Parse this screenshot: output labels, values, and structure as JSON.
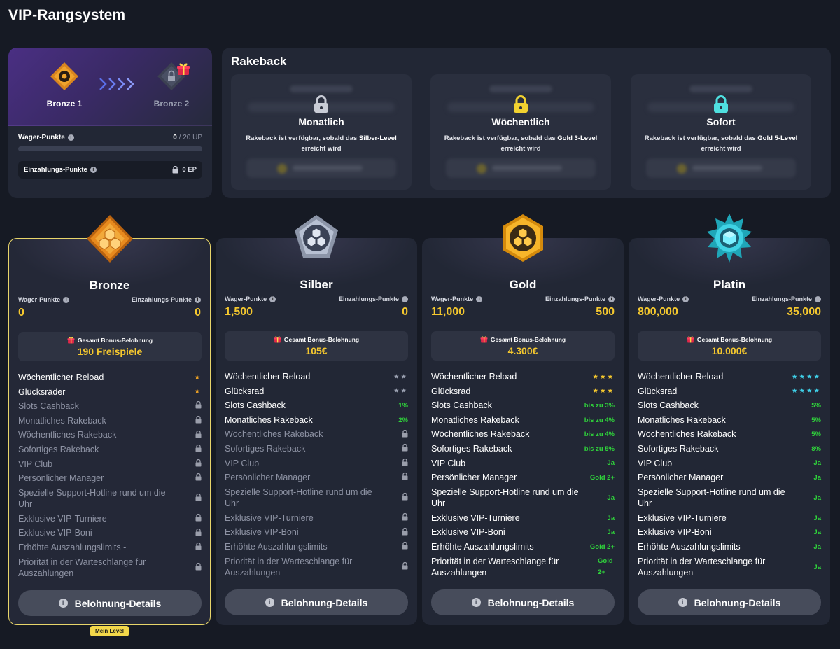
{
  "page": {
    "title": "VIP-Rangsystem"
  },
  "progress": {
    "current_rank": "Bronze 1",
    "next_rank": "Bronze 2",
    "wager_label": "Wager-Punkte",
    "wager_current": "0",
    "wager_target": "/ 20 UP",
    "wager_fraction": 0,
    "deposit_label": "Einzahlungs-Punkte",
    "deposit_value": "0 EP"
  },
  "rakeback": {
    "title": "Rakeback",
    "tiles": [
      {
        "name": "Monatlich",
        "desc_pre": "Rakeback ist verfügbar, sobald das ",
        "desc_bold": "Silber-Level",
        "desc_post": " erreicht wird",
        "lock_color": "#c9ccd6"
      },
      {
        "name": "Wöchentlich",
        "desc_pre": "Rakeback ist verfügbar, sobald das ",
        "desc_bold": "Gold 3-Level",
        "desc_post": " erreicht wird",
        "lock_color": "#f2d230"
      },
      {
        "name": "Sofort",
        "desc_pre": "Rakeback ist verfügbar, sobald das ",
        "desc_bold": "Gold 5-Level",
        "desc_post": " erreicht wird",
        "lock_color": "#4fe0e0"
      }
    ]
  },
  "labels": {
    "wager": "Wager-Punkte",
    "deposit": "Einzahlungs-Punkte",
    "bonus_total": "Gesamt Bonus-Belohnung",
    "details_button": "Belohnung-Details",
    "my_level": "Mein Level"
  },
  "tiers": [
    {
      "name": "Bronze",
      "wager": "0",
      "deposit": "0",
      "bonus": "190 Freispiele",
      "features": [
        {
          "name": "Wöchentlicher Reload",
          "value": "★",
          "type": "stars",
          "color": "#f5a623",
          "on": true
        },
        {
          "name": "Glücksräder",
          "value": "★",
          "type": "stars",
          "color": "#f5a623",
          "on": true
        },
        {
          "name": "Slots Cashback",
          "type": "lock"
        },
        {
          "name": "Monatliches Rakeback",
          "type": "lock"
        },
        {
          "name": "Wöchentliches Rakeback",
          "type": "lock"
        },
        {
          "name": "Sofortiges Rakeback",
          "type": "lock"
        },
        {
          "name": "VIP Club",
          "type": "lock"
        },
        {
          "name": "Persönlicher Manager",
          "type": "lock"
        },
        {
          "name": "Spezielle Support-Hotline rund um die Uhr",
          "type": "lock",
          "tall": true
        },
        {
          "name": "Exklusive VIP-Turniere",
          "type": "lock"
        },
        {
          "name": "Exklusive VIP-Boni",
          "type": "lock"
        },
        {
          "name": "Erhöhte Auszahlungslimits -",
          "type": "lock"
        },
        {
          "name": "Priorität in der Warteschlange für Auszahlungen",
          "type": "lock",
          "tall": true
        }
      ]
    },
    {
      "name": "Silber",
      "wager": "1,500",
      "deposit": "0",
      "bonus": "105€",
      "features": [
        {
          "name": "Wöchentlicher Reload",
          "value": "★★",
          "type": "stars",
          "color": "#9aa0b0",
          "on": true
        },
        {
          "name": "Glücksrad",
          "value": "★★",
          "type": "stars",
          "color": "#9aa0b0",
          "on": true
        },
        {
          "name": "Slots Cashback",
          "value": "1%",
          "type": "text",
          "on": true
        },
        {
          "name": "Monatliches Rakeback",
          "value": "2%",
          "type": "text",
          "on": true
        },
        {
          "name": "Wöchentliches Rakeback",
          "type": "lock"
        },
        {
          "name": "Sofortiges Rakeback",
          "type": "lock"
        },
        {
          "name": "VIP Club",
          "type": "lock"
        },
        {
          "name": "Persönlicher Manager",
          "type": "lock"
        },
        {
          "name": "Spezielle Support-Hotline rund um die Uhr",
          "type": "lock",
          "tall": true
        },
        {
          "name": "Exklusive VIP-Turniere",
          "type": "lock"
        },
        {
          "name": "Exklusive VIP-Boni",
          "type": "lock"
        },
        {
          "name": "Erhöhte Auszahlungslimits -",
          "type": "lock"
        },
        {
          "name": "Priorität in der Warteschlange für Auszahlungen",
          "type": "lock",
          "tall": true
        }
      ]
    },
    {
      "name": "Gold",
      "wager": "11,000",
      "deposit": "500",
      "bonus": "4.300€",
      "features": [
        {
          "name": "Wöchentlicher Reload",
          "value": "★★★",
          "type": "stars",
          "color": "#f5c82e",
          "on": true
        },
        {
          "name": "Glücksrad",
          "value": "★★★",
          "type": "stars",
          "color": "#f5c82e",
          "on": true
        },
        {
          "name": "Slots Cashback",
          "value": "bis zu 3%",
          "type": "text",
          "on": true
        },
        {
          "name": "Monatliches Rakeback",
          "value": "bis zu 4%",
          "type": "text",
          "on": true
        },
        {
          "name": "Wöchentliches Rakeback",
          "value": "bis zu 4%",
          "type": "text",
          "on": true
        },
        {
          "name": "Sofortiges Rakeback",
          "value": "bis zu 5%",
          "type": "text",
          "on": true
        },
        {
          "name": "VIP Club",
          "value": "Ja",
          "type": "text",
          "on": true
        },
        {
          "name": "Persönlicher Manager",
          "value": "Gold 2+",
          "type": "text",
          "on": true
        },
        {
          "name": "Spezielle Support-Hotline rund um die Uhr",
          "value": "Ja",
          "type": "text",
          "on": true,
          "tall": true
        },
        {
          "name": "Exklusive VIP-Turniere",
          "value": "Ja",
          "type": "text",
          "on": true
        },
        {
          "name": "Exklusive VIP-Boni",
          "value": "Ja",
          "type": "text",
          "on": true
        },
        {
          "name": "Erhöhte Auszahlungslimits -",
          "value": "Gold 2+",
          "type": "text",
          "on": true
        },
        {
          "name": "Priorität in der Warteschlange für Auszahlungen",
          "value": "Gold 2+",
          "type": "text",
          "on": true,
          "tall": true,
          "wrap": true
        }
      ]
    },
    {
      "name": "Platin",
      "wager": "800,000",
      "deposit": "35,000",
      "bonus": "10.000€",
      "features": [
        {
          "name": "Wöchentlicher Reload",
          "value": "★★★★",
          "type": "stars",
          "color": "#3fd0e8",
          "on": true
        },
        {
          "name": "Glücksrad",
          "value": "★★★★",
          "type": "stars",
          "color": "#3fd0e8",
          "on": true
        },
        {
          "name": "Slots Cashback",
          "value": "5%",
          "type": "text",
          "on": true
        },
        {
          "name": "Monatliches Rakeback",
          "value": "5%",
          "type": "text",
          "on": true
        },
        {
          "name": "Wöchentliches Rakeback",
          "value": "5%",
          "type": "text",
          "on": true
        },
        {
          "name": "Sofortiges Rakeback",
          "value": "8%",
          "type": "text",
          "on": true
        },
        {
          "name": "VIP Club",
          "value": "Ja",
          "type": "text",
          "on": true
        },
        {
          "name": "Persönlicher Manager",
          "value": "Ja",
          "type": "text",
          "on": true
        },
        {
          "name": "Spezielle Support-Hotline rund um die Uhr",
          "value": "Ja",
          "type": "text",
          "on": true,
          "tall": true
        },
        {
          "name": "Exklusive VIP-Turniere",
          "value": "Ja",
          "type": "text",
          "on": true
        },
        {
          "name": "Exklusive VIP-Boni",
          "value": "Ja",
          "type": "text",
          "on": true
        },
        {
          "name": "Erhöhte Auszahlungslimits -",
          "value": "Ja",
          "type": "text",
          "on": true
        },
        {
          "name": "Priorität in der Warteschlange für Auszahlungen",
          "value": "Ja",
          "type": "text",
          "on": true,
          "tall": true
        }
      ]
    }
  ]
}
